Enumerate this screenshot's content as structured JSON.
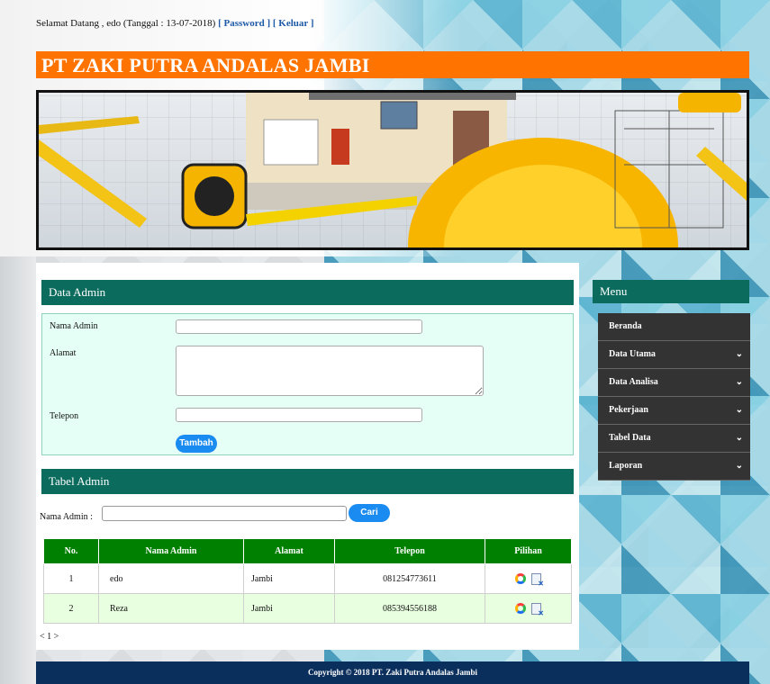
{
  "header": {
    "welcome_text": "Selamat Datang , edo (Tanggal : 13-07-2018)",
    "password_link": "[ Password ]",
    "logout_link": "[ Keluar ]",
    "company_title": "PT ZAKI PUTRA ANDALAS JAMBI"
  },
  "form": {
    "section_title": "Data Admin",
    "nama_label": "Nama Admin",
    "nama_value": "",
    "alamat_label": "Alamat",
    "alamat_value": "",
    "telepon_label": "Telepon",
    "telepon_value": "",
    "submit_label": "Tambah"
  },
  "table_section": {
    "title": "Tabel Admin",
    "search_label": "Nama Admin :",
    "search_value": "",
    "search_button": "Cari",
    "columns": [
      "No.",
      "Nama Admin",
      "Alamat",
      "Telepon",
      "Pilihan"
    ],
    "rows": [
      {
        "no": "1",
        "nama": "edo",
        "alamat": "Jambi",
        "telepon": "081254773611"
      },
      {
        "no": "2",
        "nama": "Reza",
        "alamat": "Jambi",
        "telepon": "085394556188"
      }
    ],
    "pagination": "< 1 >"
  },
  "menu": {
    "title": "Menu",
    "items": [
      "Beranda",
      "Data Utama",
      "Data Analisa",
      "Pekerjaan",
      "Tabel Data",
      "Laporan"
    ],
    "chevron": "⌄"
  },
  "footer": {
    "text": "Copyright © 2018 PT. Zaki Putra Andalas Jambi"
  },
  "colors": {
    "title_bar": "#ff7400",
    "section_header": "#0b6b5d",
    "table_header": "#008000",
    "button": "#1a8bf0",
    "footer": "#0b2f5c"
  }
}
